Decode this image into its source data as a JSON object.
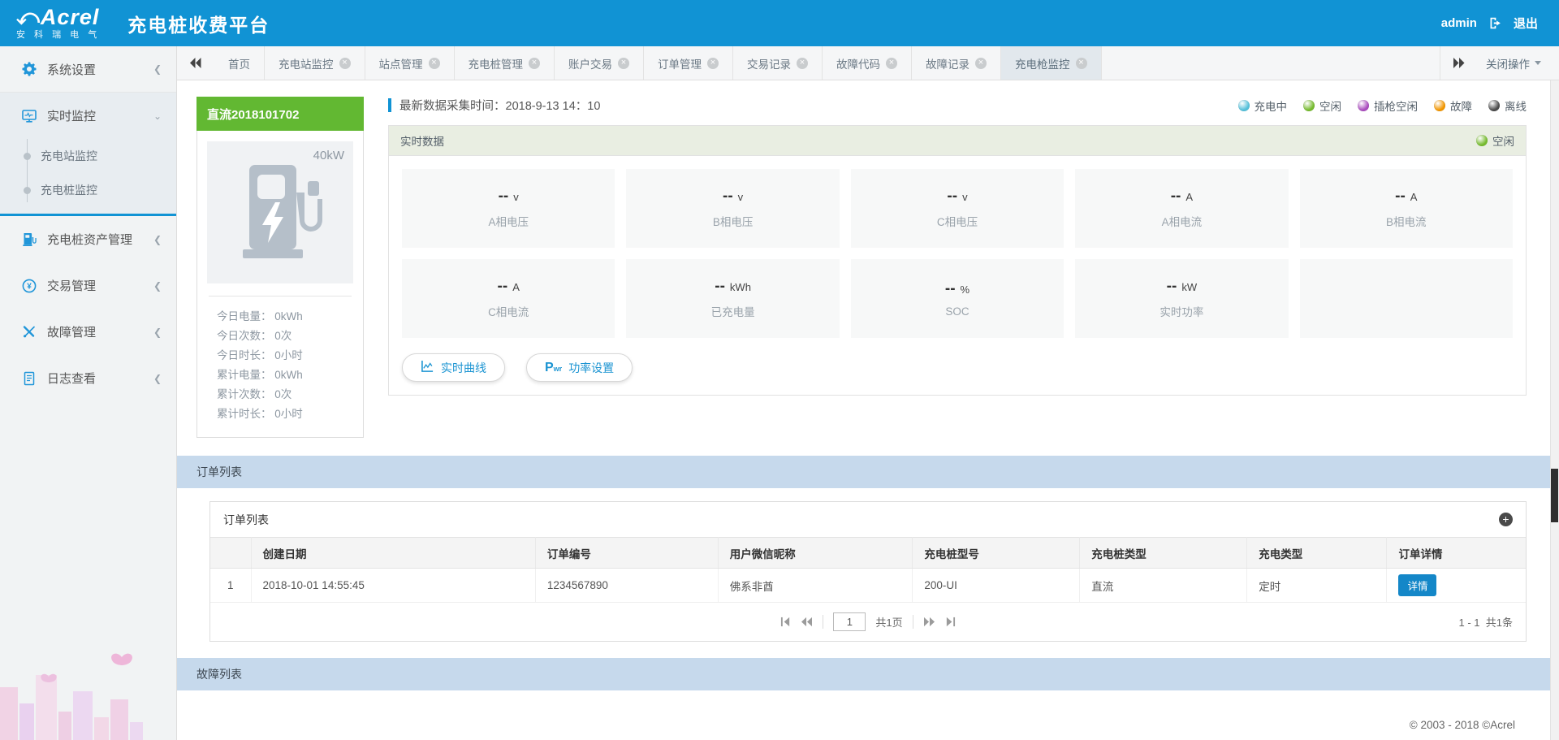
{
  "header": {
    "logo_text": "Acrel",
    "logo_subtext": "安 科 瑞 电 气",
    "title": "充电桩收费平台",
    "username": "admin",
    "logout_label": "退出"
  },
  "sidebar": {
    "items": [
      {
        "label": "系统设置"
      },
      {
        "label": "实时监控"
      },
      {
        "label": "充电桩资产管理"
      },
      {
        "label": "交易管理"
      },
      {
        "label": "故障管理"
      },
      {
        "label": "日志查看"
      }
    ],
    "submenu": [
      {
        "label": "充电站监控"
      },
      {
        "label": "充电桩监控"
      }
    ]
  },
  "tabs": {
    "items": [
      {
        "label": "首页"
      },
      {
        "label": "充电站监控"
      },
      {
        "label": "站点管理"
      },
      {
        "label": "充电桩管理"
      },
      {
        "label": "账户交易"
      },
      {
        "label": "订单管理"
      },
      {
        "label": "交易记录"
      },
      {
        "label": "故障代码"
      },
      {
        "label": "故障记录"
      },
      {
        "label": "充电枪监控"
      }
    ],
    "active": "充电枪监控",
    "close_ops_label": "关闭操作"
  },
  "device_card": {
    "title": "直流2018101702",
    "power": "40kW",
    "stats": [
      {
        "text": "今日电量： 0kWh"
      },
      {
        "text": "今日次数： 0次"
      },
      {
        "text": "今日时长： 0小时"
      },
      {
        "text": "累计电量： 0kWh"
      },
      {
        "text": "累计次数： 0次"
      },
      {
        "text": "累计时长： 0小时"
      }
    ]
  },
  "realtime": {
    "collect_time": "最新数据采集时间：2018-9-13 14：10",
    "legend": [
      {
        "label": "充电中",
        "color": "#54c0da"
      },
      {
        "label": "空闲",
        "color": "#76bb2e"
      },
      {
        "label": "插枪空闲",
        "color": "#aa4cbe"
      },
      {
        "label": "故障",
        "color": "#f29600"
      },
      {
        "label": "离线",
        "color": "#4a4a4a"
      }
    ],
    "panel_title": "实时数据",
    "status": "空闲",
    "status_color": "#76bb2e",
    "tiles": [
      {
        "value": "--",
        "unit": "v",
        "label": "A相电压"
      },
      {
        "value": "--",
        "unit": "v",
        "label": "B相电压"
      },
      {
        "value": "--",
        "unit": "v",
        "label": "C相电压"
      },
      {
        "value": "--",
        "unit": "A",
        "label": "A相电流"
      },
      {
        "value": "--",
        "unit": "A",
        "label": "B相电流"
      },
      {
        "value": "--",
        "unit": "A",
        "label": "C相电流"
      },
      {
        "value": "--",
        "unit": "kWh",
        "label": "已充电量"
      },
      {
        "value": "--",
        "unit": "%",
        "label": "SOC"
      },
      {
        "value": "--",
        "unit": "kW",
        "label": "实时功率"
      }
    ],
    "buttons": [
      {
        "label": "实时曲线"
      },
      {
        "label": "功率设置",
        "icon_main": "P",
        "icon_sub": "wr"
      }
    ]
  },
  "orders": {
    "section_title": "订单列表",
    "panel_title": "订单列表",
    "headers": [
      "创建日期",
      "订单编号",
      "用户微信昵称",
      "充电桩型号",
      "充电桩类型",
      "充电类型",
      "订单详情"
    ],
    "rows": [
      {
        "index": "1",
        "created": "2018-10-01 14:55:45",
        "order_no": "1234567890",
        "wechat_nick": "佛系非酋",
        "pile_model": "200-UI",
        "pile_type": "直流",
        "charge_type": "定时",
        "detail_label": "详情"
      }
    ],
    "pagination": {
      "page_value": "1",
      "total_pages_label": "共1页",
      "range_label": "1 - 1",
      "total_label": "共1条"
    }
  },
  "faults": {
    "section_title": "故障列表"
  },
  "footer": {
    "copyright": "© 2003 - 2018 ©Acrel"
  },
  "colors": {
    "header_blue": "#1193d4",
    "card_green": "#62b832",
    "section_bar_blue": "#c6d9ec",
    "detail_button_blue": "#1487c8"
  }
}
